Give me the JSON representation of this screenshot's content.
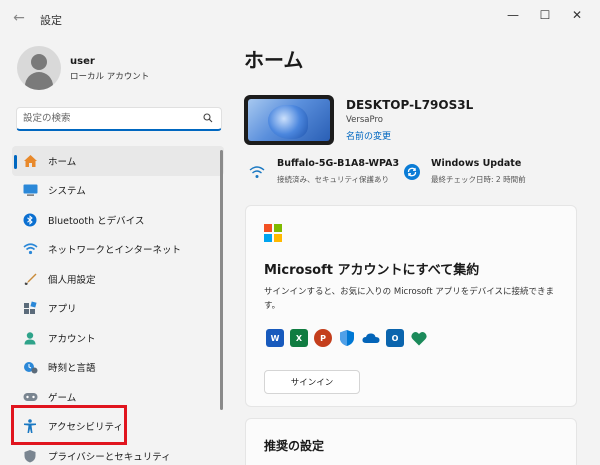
{
  "window": {
    "title": "設定",
    "back_glyph": "←",
    "minimize_glyph": "—",
    "maximize_glyph": "☐",
    "close_glyph": "✕"
  },
  "user": {
    "name": "user",
    "account_type": "ローカル アカウント",
    "avatar_icon": "person-avatar-icon"
  },
  "search": {
    "placeholder": "設定の検索",
    "icon": "search-icon"
  },
  "nav": {
    "items": [
      {
        "label": "ホーム",
        "icon": "home-icon",
        "active": true
      },
      {
        "label": "システム",
        "icon": "system-icon",
        "active": false
      },
      {
        "label": "Bluetooth とデバイス",
        "icon": "bluetooth-icon",
        "active": false
      },
      {
        "label": "ネットワークとインターネット",
        "icon": "network-icon",
        "active": false
      },
      {
        "label": "個人用設定",
        "icon": "personalization-icon",
        "active": false
      },
      {
        "label": "アプリ",
        "icon": "apps-icon",
        "active": false
      },
      {
        "label": "アカウント",
        "icon": "accounts-icon",
        "active": false
      },
      {
        "label": "時刻と言語",
        "icon": "time-language-icon",
        "active": false
      },
      {
        "label": "ゲーム",
        "icon": "gaming-icon",
        "active": false
      },
      {
        "label": "アクセシビリティ",
        "icon": "accessibility-icon",
        "active": false,
        "highlighted": true
      },
      {
        "label": "プライバシーとセキュリティ",
        "icon": "privacy-icon",
        "active": false
      }
    ],
    "highlight_color": "#e0141e",
    "accent_color": "#0067c0"
  },
  "main": {
    "title": "ホーム",
    "device": {
      "name": "DESKTOP-L79OS3L",
      "model": "VersaPro",
      "rename_link": "名前の変更"
    },
    "wifi": {
      "name": "Buffalo-5G-B1A8-WPA3",
      "status": "接続済み、セキュリティ保護あり",
      "icon": "wifi-icon"
    },
    "update": {
      "title": "Windows Update",
      "status": "最終チェック日時: 2 時間前",
      "icon": "windows-update-icon"
    },
    "account_card": {
      "title": "Microsoft アカウントにすべて集約",
      "description": "サインインすると、お気に入りの Microsoft アプリをデバイスに接続できます。",
      "signin_label": "サインイン",
      "apps": [
        {
          "icon": "word-icon",
          "letter": "W",
          "color": "#185abd"
        },
        {
          "icon": "excel-icon",
          "letter": "X",
          "color": "#107c41"
        },
        {
          "icon": "powerpoint-icon",
          "letter": "P",
          "color": "#c43e1c"
        },
        {
          "icon": "defender-icon",
          "letter": "",
          "color": "#0078d4"
        },
        {
          "icon": "onedrive-icon",
          "letter": "",
          "color": "#0364b8"
        },
        {
          "icon": "outlook-icon",
          "letter": "O",
          "color": "#0a64ad"
        },
        {
          "icon": "family-safety-icon",
          "letter": "",
          "color": "#1b8a5a"
        }
      ]
    },
    "recommended_card": {
      "title": "推奨の設定"
    }
  }
}
